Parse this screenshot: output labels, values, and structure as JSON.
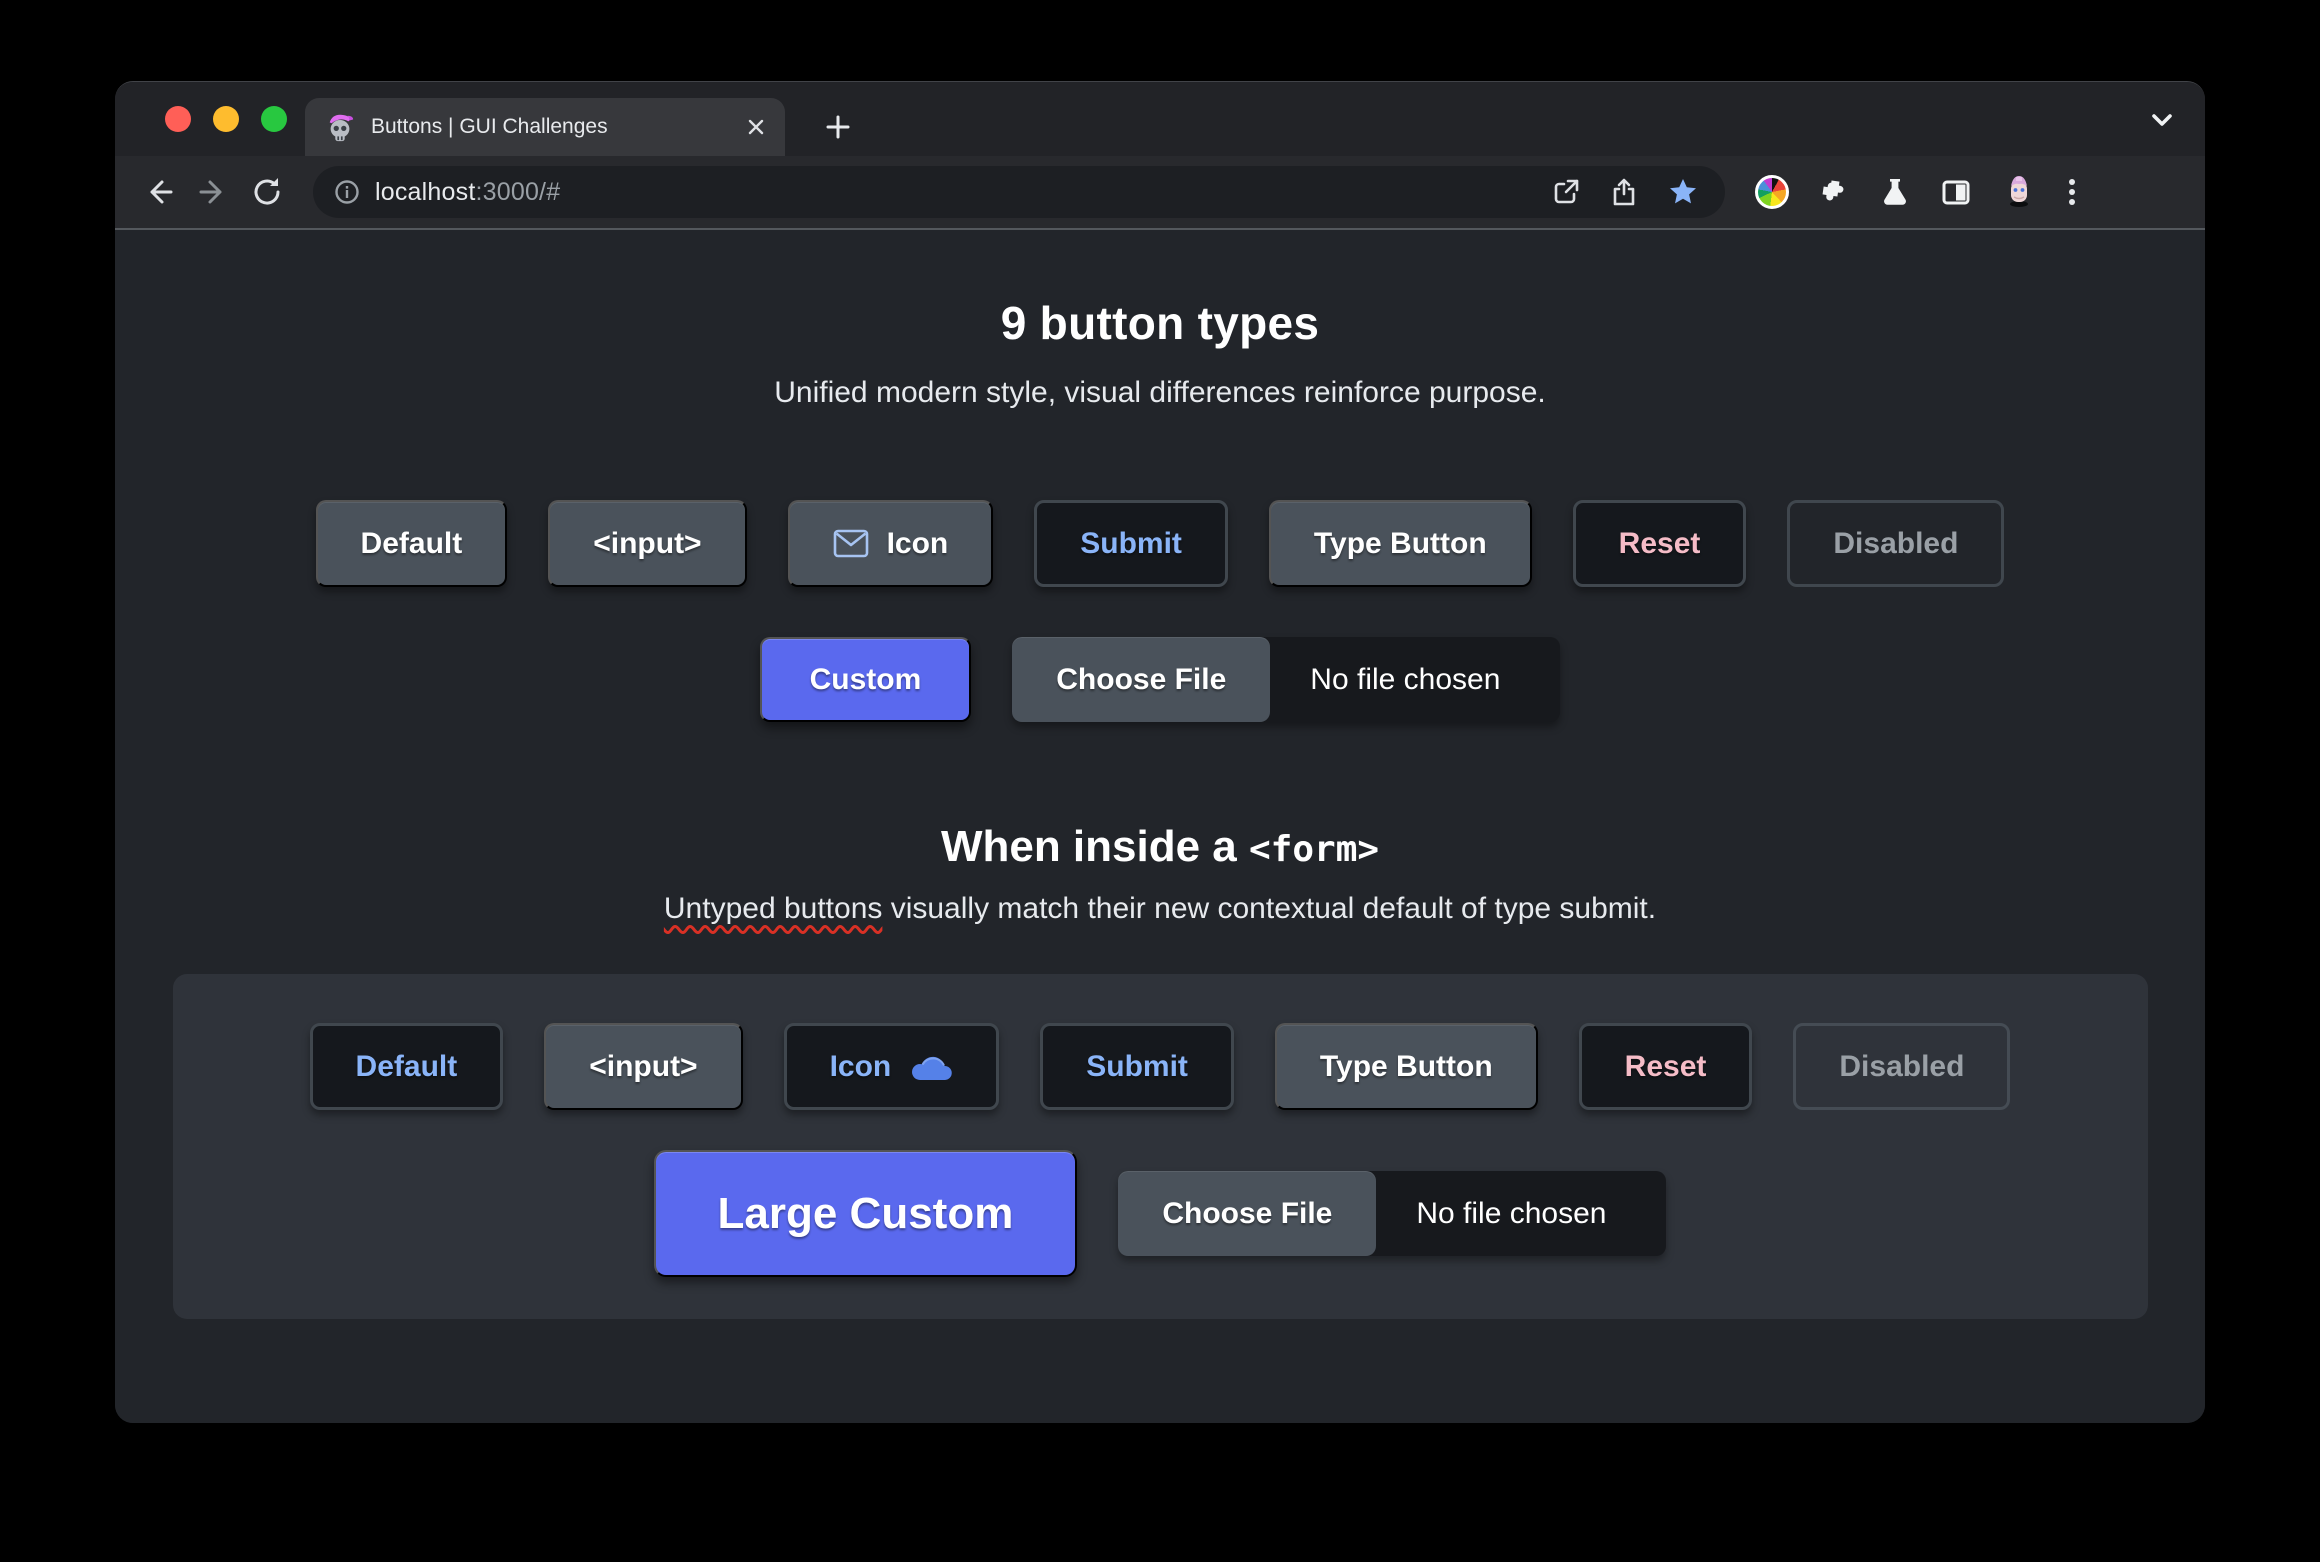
{
  "browser": {
    "window_controls": {
      "close": "#ff5f57",
      "minimize": "#febc2e",
      "zoom": "#28c840"
    },
    "tab": {
      "title": "Buttons | GUI Challenges",
      "favicon": "skull-with-pink-cap"
    },
    "address": {
      "host": "localhost",
      "path": ":3000/#"
    },
    "toolbar_icons": [
      "back",
      "forward",
      "reload",
      "info",
      "open-in-new",
      "share",
      "bookmark-star",
      "color-wheel-extension",
      "extensions-puzzle",
      "experiments-flask",
      "side-panel",
      "profile-avatar",
      "menu-dots"
    ]
  },
  "colors": {
    "accent_primary": "#5a69ee",
    "submit_blue": "#8ab4f8",
    "reset_pink": "#f5bcc7",
    "disabled_gray": "#9aa0a6",
    "button_gray": "#4a525b",
    "page_bg": "#22252a",
    "panel_bg": "#2f333a"
  },
  "page": {
    "hero": {
      "title": "9 button types",
      "subtitle": "Unified modern style, visual differences reinforce purpose."
    },
    "row1": {
      "buttons": [
        {
          "label": "Default",
          "style": "default"
        },
        {
          "label": "<input>",
          "style": "input-element"
        },
        {
          "label": "Icon",
          "style": "with-mail-icon"
        },
        {
          "label": "Submit",
          "style": "submit"
        },
        {
          "label": "Type Button",
          "style": "type-button"
        },
        {
          "label": "Reset",
          "style": "reset"
        },
        {
          "label": "Disabled",
          "style": "disabled"
        }
      ]
    },
    "row2": {
      "custom_label": "Custom",
      "file": {
        "button_label": "Choose File",
        "status": "No file chosen"
      }
    },
    "form": {
      "title": "When inside a ",
      "title_code": "<form>",
      "subtitle_marked": "Untyped buttons",
      "subtitle_rest": " visually match their new contextual default of type submit.",
      "row1": {
        "buttons": [
          {
            "label": "Default",
            "style": "default-as-submit"
          },
          {
            "label": "<input>",
            "style": "input-element"
          },
          {
            "label": "Icon",
            "style": "with-cloud-icon"
          },
          {
            "label": "Submit",
            "style": "submit"
          },
          {
            "label": "Type Button",
            "style": "type-button"
          },
          {
            "label": "Reset",
            "style": "reset"
          },
          {
            "label": "Disabled",
            "style": "disabled"
          }
        ]
      },
      "row2": {
        "large_custom_label": "Large Custom",
        "file": {
          "button_label": "Choose File",
          "status": "No file chosen"
        }
      }
    }
  }
}
